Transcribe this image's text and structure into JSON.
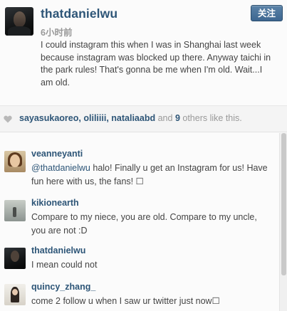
{
  "post": {
    "username": "thatdanielwu",
    "time_ago": "6小时前",
    "follow_label": "关注",
    "caption": "I could instagram this when I was in Shanghai last week because instagram was blocked up there. Anyway taichi in the park rules! That's gonna be me when I'm old. Wait...I am old."
  },
  "likes": {
    "likers": [
      "sayasukaoreo",
      "oliliiii",
      "nataliaabd"
    ],
    "separator": ",",
    "and_word": "and",
    "count": "9",
    "suffix": "others like this."
  },
  "comments": [
    {
      "username": "veanneyanti",
      "mention": "@thatdanielwu",
      "text": " halo! Finally u get an Instagram for us! Have fun here with us, the fans! ☐"
    },
    {
      "username": "kikionearth",
      "text": "Compare to my niece, you are old. Compare to my uncle, you are not :D"
    },
    {
      "username": "thatdanielwu",
      "text": "I mean could not"
    },
    {
      "username": "quincy_zhang_",
      "text": "come 2 follow u when I saw ur twitter just now☐"
    }
  ],
  "colors": {
    "username": "#2d5577",
    "follow_button": "#4a739b",
    "muted_text": "#999999"
  },
  "icons": {
    "like": "heart-icon"
  }
}
